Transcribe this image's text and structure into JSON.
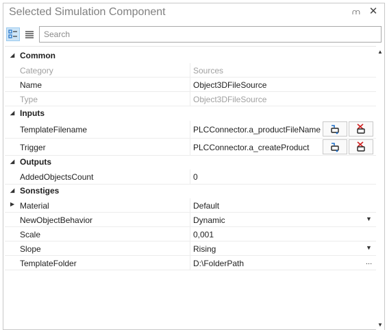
{
  "window": {
    "title": "Selected Simulation Component",
    "pin_glyph": "⩋",
    "close_glyph": "✕"
  },
  "toolbar": {
    "search_placeholder": "Search"
  },
  "grid": {
    "categories": [
      {
        "label": "Common"
      },
      {
        "label": "Inputs"
      },
      {
        "label": "Outputs"
      },
      {
        "label": "Sonstiges"
      }
    ],
    "common": {
      "category": {
        "name": "Category",
        "value": "Sources"
      },
      "name": {
        "name": "Name",
        "value": "Object3DFileSource"
      },
      "type": {
        "name": "Type",
        "value": "Object3DFileSource"
      }
    },
    "inputs": {
      "template_filename": {
        "name": "TemplateFilename",
        "value": "PLCConnector.a_productFileName"
      },
      "trigger": {
        "name": "Trigger",
        "value": "PLCConnector.a_createProduct"
      }
    },
    "outputs": {
      "added_objects_count": {
        "name": "AddedObjectsCount",
        "value": "0"
      }
    },
    "sonstiges": {
      "material": {
        "name": "Material",
        "value": "Default"
      },
      "new_object_behavior": {
        "name": "NewObjectBehavior",
        "value": "Dynamic"
      },
      "scale": {
        "name": "Scale",
        "value": "0,001"
      },
      "slope": {
        "name": "Slope",
        "value": "Rising"
      },
      "template_folder": {
        "name": "TemplateFolder",
        "value": "D:\\FolderPath"
      }
    },
    "ellipsis": "..."
  },
  "icons": {
    "categorized_view": "categorized-view-icon",
    "alphabetical_view": "alphabetical-view-icon",
    "connect": "connect-signal-icon",
    "disconnect": "disconnect-signal-icon",
    "collapse": "collapse-triangle-icon",
    "expand": "expand-triangle-icon",
    "dropdown": "dropdown-arrow-icon"
  },
  "colors": {
    "accent": "#1e6fc8",
    "active_button": "#cce4f7",
    "disabled_text": "#a0a0a0",
    "disconnect_red": "#d02020"
  }
}
